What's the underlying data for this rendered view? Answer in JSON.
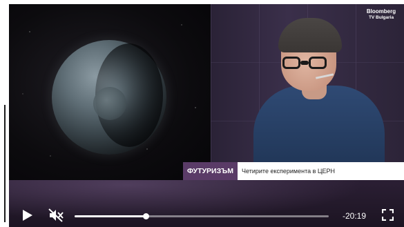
{
  "video": {
    "logo_line1": "Bloomberg",
    "logo_line2": "TV Bulgaria",
    "lower_third_category": "ФУТУРИЗЪМ",
    "lower_third_title": "Четирите експеримента в ЦЕРН",
    "category_color": "#5a3b67"
  },
  "controls": {
    "play_icon": "play-icon",
    "mute_icon": "muted-speaker-icon",
    "fullscreen_icon": "fullscreen-icon",
    "time_remaining": "-20:19",
    "progress_fraction": 0.28
  }
}
